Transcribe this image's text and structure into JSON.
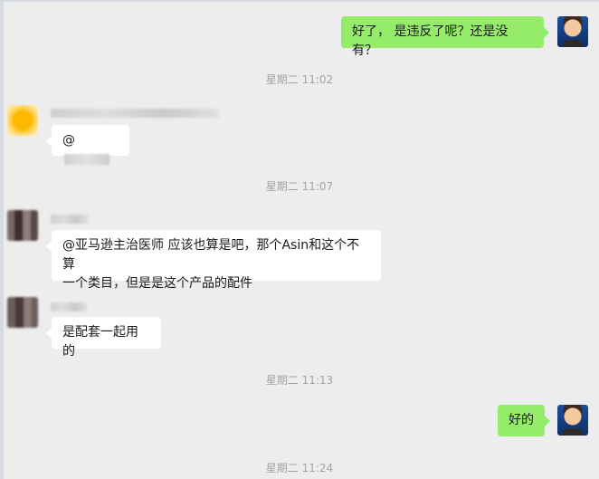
{
  "messages": [
    {
      "side": "out",
      "text": "好了， 是违反了呢？还是没有？"
    },
    {
      "time": "星期二 11:02"
    },
    {
      "side": "in",
      "text": "@"
    },
    {
      "time": "星期二 11:07"
    },
    {
      "side": "in",
      "text_line1": "@亚马逊主治医师 应该也算是吧，那个Asin和这个不算",
      "text_line2": "一个类目，但是是这个产品的配件"
    },
    {
      "side": "in",
      "text": "是配套一起用的"
    },
    {
      "time": "星期二 11:13"
    },
    {
      "side": "out",
      "text": "好的"
    },
    {
      "time": "星期二 11:24"
    }
  ],
  "colors": {
    "outgoing_bubble": "#95ec69",
    "incoming_bubble": "#ffffff",
    "background": "#ededed"
  }
}
